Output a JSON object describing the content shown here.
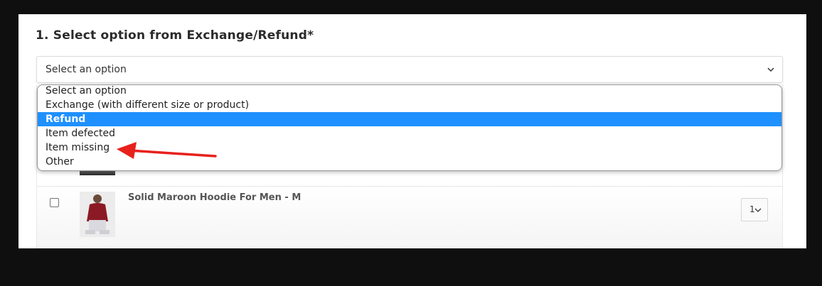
{
  "section": {
    "heading": "1. Select option from Exchange/Refund*"
  },
  "select": {
    "current_value": "Select an option",
    "options": [
      "Select an option",
      "Exchange (with different size or product)",
      "Refund",
      "Item defected",
      "Item missing",
      "Other"
    ],
    "highlighted_index": 2
  },
  "product": {
    "title": "Solid Maroon Hoodie For Men - M",
    "quantity": "1"
  },
  "colors": {
    "highlight": "#1e90ff",
    "arrow": "#e8211c",
    "page_background": "#0f0f0f"
  },
  "icons": {
    "select_chevron": "chevron-down-icon",
    "annotation": "red-arrow-icon"
  }
}
